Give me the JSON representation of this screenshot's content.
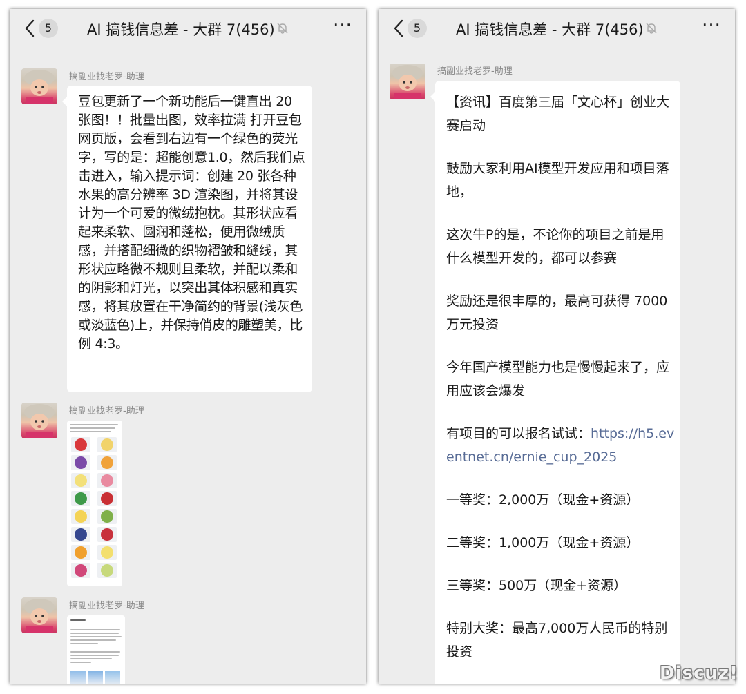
{
  "chat": {
    "back_count": "5",
    "title": "AI 搞钱信息差 - 大群 7(456)",
    "more": "···"
  },
  "left": {
    "messages": [
      {
        "sender": "搞副业找老罗-助理",
        "text": "豆包更新了一个新功能后一键直出 20 张图！！批量出图，效率拉满 打开豆包网页版，会看到右边有一个绿色的荧光字，写的是：超能创意1.0，然后我们点击进入，输入提示词：创建 20 张各种水果的高分辨率 3D 渲染图，并将其设计为一个可爱的微绒抱枕。其形状应看起来柔软、圆润和蓬松，便用微绒质感，并搭配细微的织物褶皱和缝线，其形状应略微不规则且柔软，并配以柔和的阴影和灯光，以突出其体积感和真实感，将其放置在干净简约的背景(浅灰色或淡蓝色)上，并保持俏皮的雕塑美，比例 4:3。"
      },
      {
        "sender": "搞副业找老罗-助理",
        "image": "fruit-pillow-grid-screenshot"
      },
      {
        "sender": "搞副业找老罗-助理",
        "image": "doc-screenshot"
      }
    ]
  },
  "right": {
    "sender": "搞副业找老罗-助理",
    "paragraphs": [
      "【资讯】百度第三届「文心杯」创业大赛启动",
      "鼓励大家利用AI模型开发应用和项目落地，",
      "这次牛P的是，不论你的项目之前是用什么模型开发的，都可以参赛",
      "奖励还是很丰厚的，最高可获得 7000万元投资",
      "今年国产模型能力也是慢慢起来了，应用应该会爆发"
    ],
    "signup_prefix": "有项目的可以报名试试：",
    "signup_link": "https://h5.eventnet.cn/ernie_cup_2025",
    "prizes": [
      "一等奖：2,000万（现金+资源）",
      "二等奖：1,000万（现金+资源）",
      "三等奖：500万（现金+资源）",
      "特别大奖：最高7,000万人民币的特别投资"
    ]
  },
  "watermark": "Discuz!",
  "colors": {
    "chat_bg": "#ededed",
    "bubble": "#ffffff",
    "link": "#576b95",
    "sender": "#8a8a8a"
  }
}
